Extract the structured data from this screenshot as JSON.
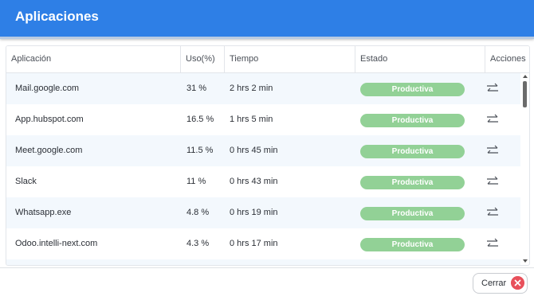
{
  "header": {
    "title": "Aplicaciones"
  },
  "table": {
    "columns": [
      "Aplicación",
      "Uso(%)",
      "Tiempo",
      "Estado",
      "Acciones"
    ],
    "rows": [
      {
        "app": "Mail.google.com",
        "usage": "31 %",
        "time": "2 hrs 2 min",
        "status": "Productiva"
      },
      {
        "app": "App.hubspot.com",
        "usage": "16.5 %",
        "time": "1 hrs 5 min",
        "status": "Productiva"
      },
      {
        "app": "Meet.google.com",
        "usage": "11.5 %",
        "time": "0 hrs 45 min",
        "status": "Productiva"
      },
      {
        "app": "Slack",
        "usage": "11 %",
        "time": "0 hrs 43 min",
        "status": "Productiva"
      },
      {
        "app": "Whatsapp.exe",
        "usage": "4.8 %",
        "time": "0 hrs 19 min",
        "status": "Productiva"
      },
      {
        "app": "Odoo.intelli-next.com",
        "usage": "4.3 %",
        "time": "0 hrs 17 min",
        "status": "Productiva"
      }
    ]
  },
  "footer": {
    "close_label": "Cerrar"
  },
  "colors": {
    "header_bg": "#2e7fe6",
    "status_productive": "#92d196",
    "close_icon": "#e8505b",
    "row_alt": "#f3f8fd"
  },
  "icons": {
    "action": "swap-arrows-icon",
    "close": "close-icon"
  }
}
